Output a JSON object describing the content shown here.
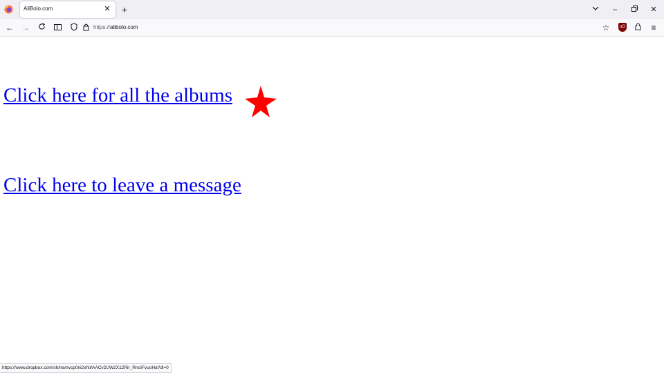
{
  "browser": {
    "tab": {
      "title": "AliBolo.com"
    },
    "url": {
      "scheme": "https://",
      "host": "alibolo.com"
    },
    "status_url": "https://www.dropbox.com/sh/lramvcp0ni2xhit/AACv2UW2X12Rir_RnoIFvuoHa?dl=0"
  },
  "page": {
    "links": [
      {
        "label": "Click here for all the albums"
      },
      {
        "label": "Click here to leave a message"
      }
    ],
    "star_color": "#ff0000",
    "link_color": "#0000ee"
  }
}
